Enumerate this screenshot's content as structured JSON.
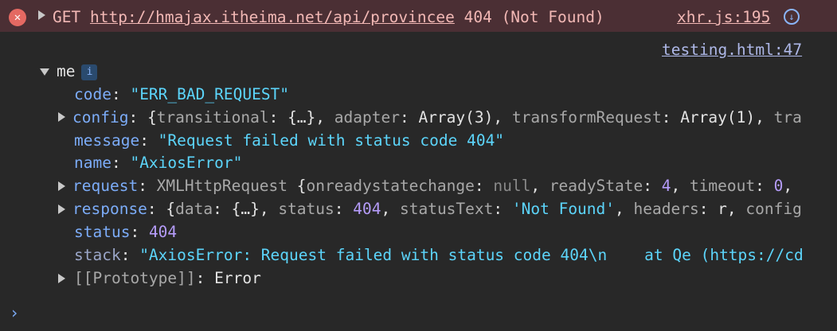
{
  "error": {
    "method": "GET",
    "url": "http://hmajax.itheima.net/api/provincee",
    "status": "404 (Not Found)",
    "source": "xhr.js:195",
    "source2": "testing.html:47"
  },
  "object": {
    "label": "me",
    "info_badge": "i",
    "code_key": "code",
    "code_val": "\"ERR_BAD_REQUEST\"",
    "config_key": "config",
    "config_val": {
      "open": "{",
      "transitional_key": "transitional",
      "transitional_val": "{…}",
      "adapter_key": "adapter",
      "adapter_val": "Array(3)",
      "transformRequest_key": "transformRequest",
      "transformRequest_val": "Array(1)",
      "tail": "tra"
    },
    "message_key": "message",
    "message_val": "\"Request failed with status code 404\"",
    "name_key": "name",
    "name_val": "\"AxiosError\"",
    "request_key": "request",
    "request_val": {
      "type": "XMLHttpRequest",
      "open": "{",
      "onready_key": "onreadystatechange",
      "onready_val": "null",
      "readyState_key": "readyState",
      "readyState_val": "4",
      "timeout_key": "timeout",
      "timeout_val": "0"
    },
    "response_key": "response",
    "response_val": {
      "open": "{",
      "data_key": "data",
      "data_val": "{…}",
      "status_key": "status",
      "status_val": "404",
      "statusText_key": "statusText",
      "statusText_val": "'Not Found'",
      "headers_key": "headers",
      "headers_val": "r",
      "tail": "config"
    },
    "status_key": "status",
    "status_val": "404",
    "stack_key": "stack",
    "stack_val": "\"AxiosError: Request failed with status code 404\\n    at Qe (https://cd",
    "prototype_key": "[[Prototype]]",
    "prototype_val": "Error"
  },
  "console_prompt": "›"
}
